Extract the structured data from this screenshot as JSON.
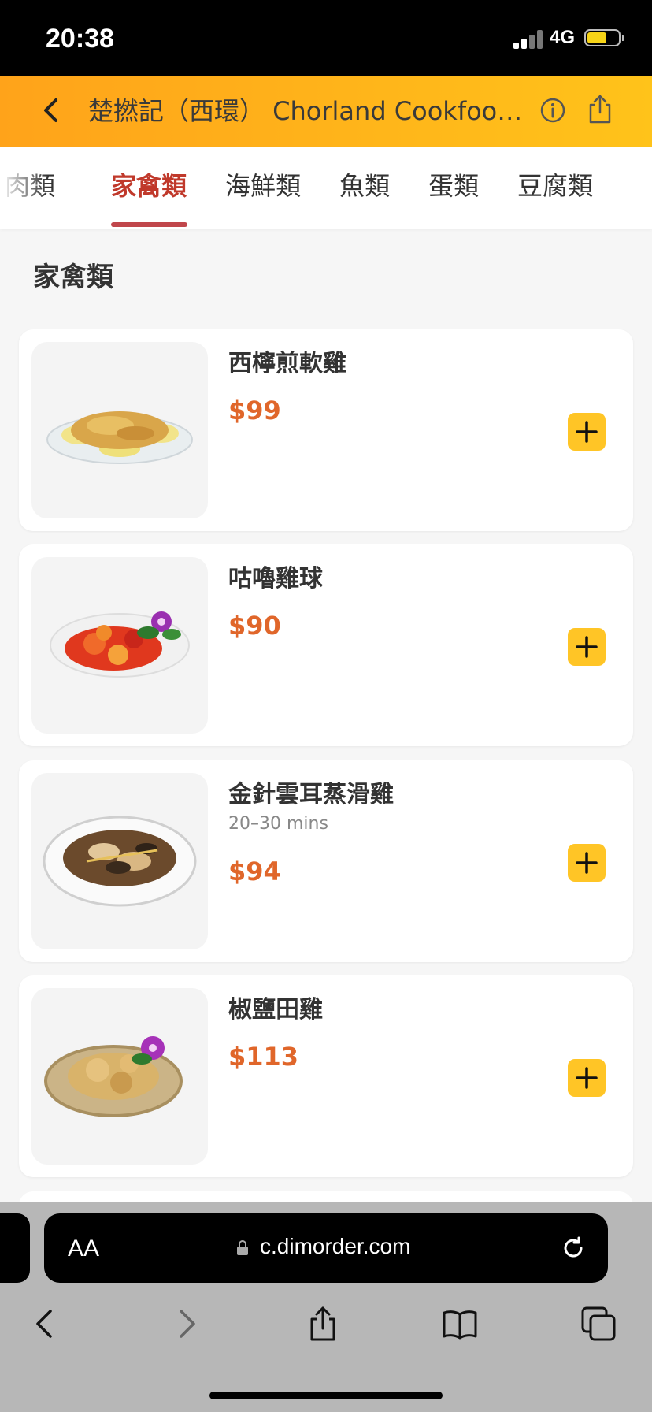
{
  "status_bar": {
    "time": "20:38",
    "network": "4G"
  },
  "header": {
    "title": "楚撚記（西環） Chorland Cookfoo…",
    "back_icon": "chevron-left-icon",
    "info_icon": "info-icon",
    "share_icon": "share-icon"
  },
  "tabs": [
    {
      "label": "肉類",
      "active": false
    },
    {
      "label": "家禽類",
      "active": true
    },
    {
      "label": "海鮮類",
      "active": false
    },
    {
      "label": "魚類",
      "active": false
    },
    {
      "label": "蛋類",
      "active": false
    },
    {
      "label": "豆腐類",
      "active": false
    }
  ],
  "section_title": "家禽類",
  "items": [
    {
      "name": "西檸煎軟雞",
      "subtitle": "",
      "price": "$99"
    },
    {
      "name": "咕嚕雞球",
      "subtitle": "",
      "price": "$90"
    },
    {
      "name": "金針雲耳蒸滑雞",
      "subtitle": "20–30 mins",
      "price": "$94"
    },
    {
      "name": "椒鹽田雞",
      "subtitle": "",
      "price": "$113"
    }
  ],
  "browser": {
    "text_size": "AA",
    "url": "c.dimorder.com"
  },
  "colors": {
    "header_start": "#ffa31a",
    "header_end": "#ffc31a",
    "active_tab": "#c0392b",
    "price": "#e0662a",
    "add_button": "#ffc526"
  }
}
